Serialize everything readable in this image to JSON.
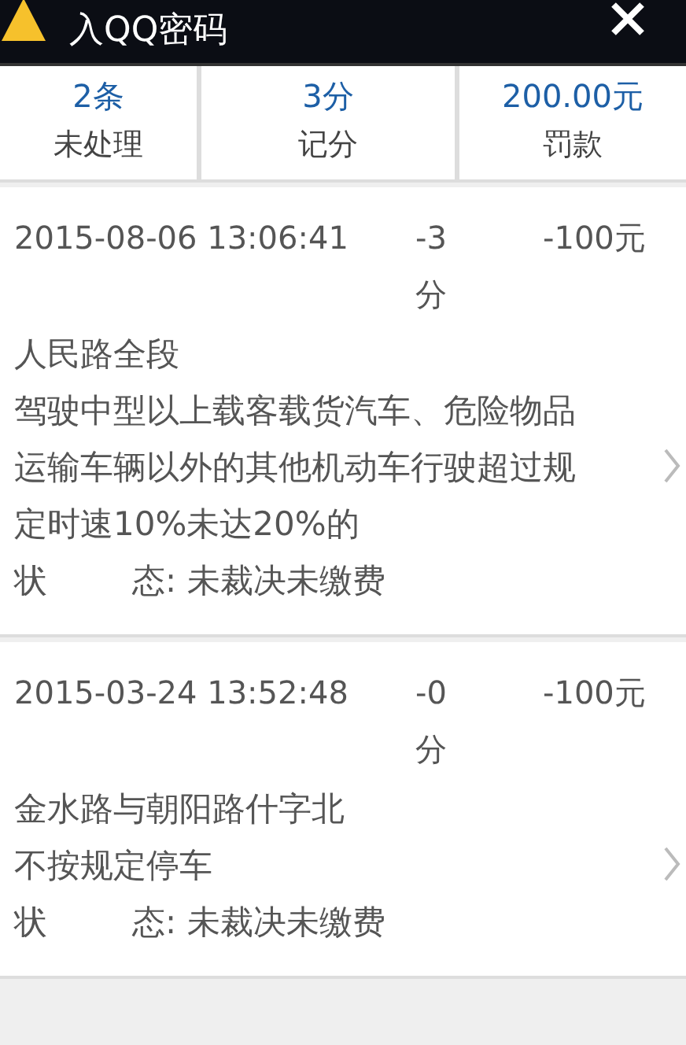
{
  "notification": {
    "message": "入QQ密码"
  },
  "summary": [
    {
      "value": "2条",
      "label": "未处理"
    },
    {
      "value": "3分",
      "label": "记分"
    },
    {
      "value": "200.00元",
      "label": "罚款"
    }
  ],
  "records": [
    {
      "time": "2015-08-06 13:06:41",
      "points": "-3分",
      "fine": "-100元",
      "place": "人民路全段",
      "violation": "驾驶中型以上载客载货汽车、危险物品运输车辆以外的其他机动车行驶超过规定时速10%未达20%的",
      "status_head": "状",
      "status_tail": "态: 未裁决未缴费"
    },
    {
      "time": "2015-03-24 13:52:48",
      "points": "-0分",
      "fine": "-100元",
      "place": "金水路与朝阳路什字北",
      "violation": "不按规定停车",
      "status_head": "状",
      "status_tail": "态: 未裁决未缴费"
    }
  ]
}
